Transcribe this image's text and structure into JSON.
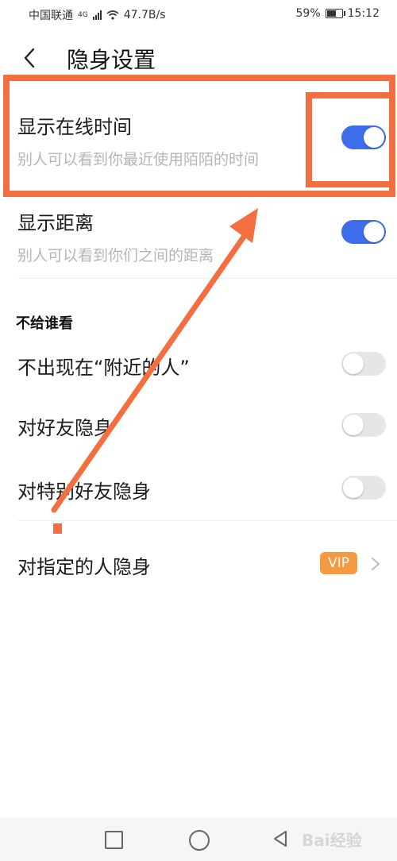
{
  "status_bar": {
    "carrier": "中国联通",
    "network": "4G",
    "speed": "47.7B/s",
    "battery": "59%",
    "battery_level": 0.59,
    "time": "15:12"
  },
  "header": {
    "title": "隐身设置",
    "back_icon": "chevron-left-icon"
  },
  "settings": [
    {
      "title": "显示在线时间",
      "subtitle": "别人可以看到你最近使用陌陌的时间",
      "on": true
    },
    {
      "title": "显示距离",
      "subtitle": "别人可以看到你们之间的距离",
      "on": true
    }
  ],
  "section_title": "不给谁看",
  "hide_items": [
    {
      "title": "不出现在“附近的人”",
      "on": false
    },
    {
      "title": "对好友隐身",
      "on": false
    },
    {
      "title": "对特别好友隐身",
      "on": false
    }
  ],
  "specific": {
    "title": "对指定的人隐身",
    "badge": "VIP"
  },
  "colors": {
    "toggle_on": "#3d6dea",
    "toggle_off": "#e6e6e6",
    "vip": "#f59a40",
    "annotation": "#f36f3f"
  },
  "watermark": "Bai经验"
}
